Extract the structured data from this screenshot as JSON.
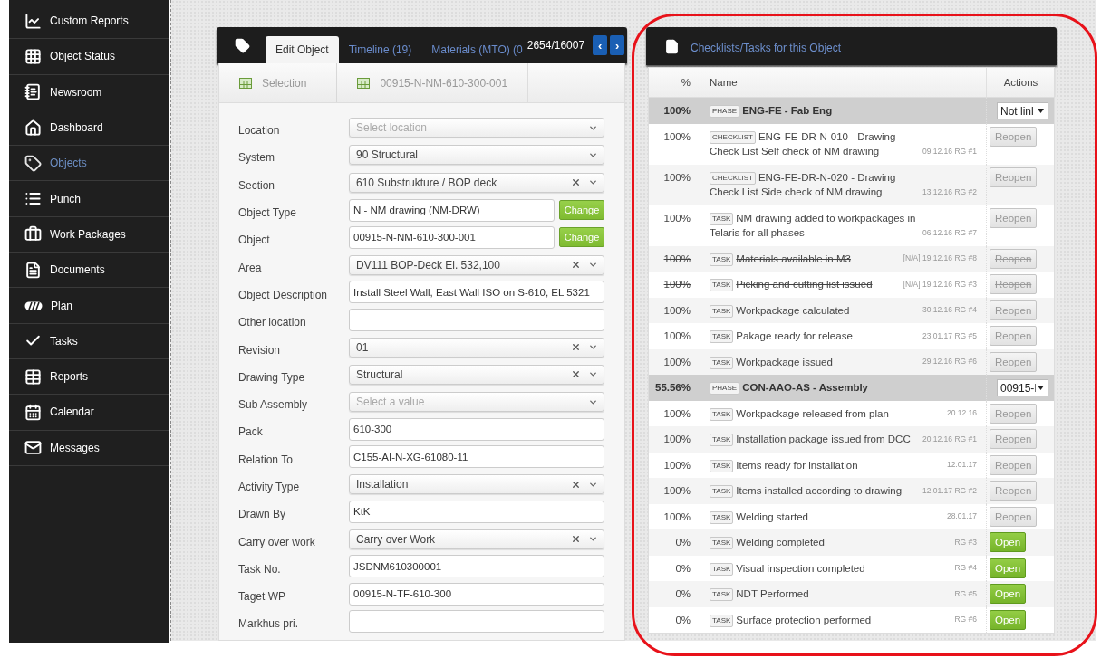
{
  "sidebar": {
    "items": [
      {
        "label": "Custom Reports",
        "selected": false
      },
      {
        "label": "Object Status",
        "selected": false
      },
      {
        "label": "Newsroom",
        "selected": false
      },
      {
        "label": "Dashboard",
        "selected": false
      },
      {
        "label": "Objects",
        "selected": true
      },
      {
        "label": "Punch",
        "selected": false
      },
      {
        "label": "Work Packages",
        "selected": false
      },
      {
        "label": "Documents",
        "selected": false
      },
      {
        "label": "Plan",
        "selected": false
      },
      {
        "label": "Tasks",
        "selected": false
      },
      {
        "label": "Reports",
        "selected": false
      },
      {
        "label": "Calendar",
        "selected": false
      },
      {
        "label": "Messages",
        "selected": false
      }
    ]
  },
  "edit_panel": {
    "tabs": [
      {
        "label": "Edit Object",
        "selected": true
      },
      {
        "label": "Timeline (19)",
        "selected": false
      },
      {
        "label": "Materials (MTO) (0",
        "selected": false
      }
    ],
    "counter": "2654/16007",
    "nav_buttons": [
      "‹",
      "›"
    ],
    "breadcrumb": [
      "Selection",
      "00915-N-NM-610-300-001"
    ],
    "fields": [
      {
        "label": "Location",
        "kind": "select",
        "placeholder": "Select location",
        "clearable": false
      },
      {
        "label": "System",
        "kind": "select",
        "value": "90 Structural",
        "clearable": false
      },
      {
        "label": "Section",
        "kind": "select",
        "value": "610 Substrukture / BOP deck",
        "clearable": true
      },
      {
        "label": "Object Type",
        "kind": "input",
        "value": "N - NM drawing (NM-DRW)",
        "button": "Change"
      },
      {
        "label": "Object",
        "kind": "input",
        "value": "00915-N-NM-610-300-001",
        "button": "Change"
      },
      {
        "label": "Area",
        "kind": "select",
        "value": "DV111 BOP-Deck El. 532,100",
        "clearable": true
      },
      {
        "label": "Object Description",
        "kind": "input",
        "value": "Install Steel Wall, East Wall ISO on S-610, EL 5321"
      },
      {
        "label": "Other location",
        "kind": "input"
      },
      {
        "label": "Revision",
        "kind": "select",
        "value": "01",
        "clearable": true
      },
      {
        "label": "Drawing Type",
        "kind": "select",
        "value": "Structural",
        "clearable": true
      },
      {
        "label": "Sub Assembly",
        "kind": "select",
        "placeholder": "Select a value",
        "clearable": false
      },
      {
        "label": "Pack",
        "kind": "input",
        "value": "610-300"
      },
      {
        "label": "Relation To",
        "kind": "input",
        "value": "C155-AI-N-XG-61080-11"
      },
      {
        "label": "Activity Type",
        "kind": "select",
        "value": "Installation",
        "clearable": true
      },
      {
        "label": "Drawn By",
        "kind": "input",
        "value": "KtK"
      },
      {
        "label": "Carry over work",
        "kind": "select",
        "value": "Carry over Work",
        "clearable": true
      },
      {
        "label": "Task No.",
        "kind": "input",
        "value": "JSDNM610300001"
      },
      {
        "label": "Taget WP",
        "kind": "input",
        "value": "00915-N-TF-610-300"
      },
      {
        "label": "Markhus pri.",
        "kind": "input"
      }
    ]
  },
  "tasks_panel": {
    "title": "Checklists/Tasks for this Object",
    "columns": [
      "%",
      "Name",
      "Actions"
    ],
    "rows": [
      {
        "kind": "phase",
        "percent": "100%",
        "tag": "PHASE",
        "name": "ENG-FE - Fab Eng",
        "action": {
          "kind": "select",
          "label": "Not linl"
        }
      },
      {
        "kind": "item",
        "percent": "100%",
        "tag": "CHECKLIST",
        "name": "ENG-FE-DR-N-010 - Drawing Check List Self check of NM drawing",
        "meta": "09.12.16 RG #1",
        "struck": false,
        "action": {
          "kind": "reopen",
          "label": "Reopen"
        }
      },
      {
        "kind": "item",
        "percent": "100%",
        "tag": "CHECKLIST",
        "name": "ENG-FE-DR-N-020 - Drawing Check List Side check of NM drawing",
        "meta": "13.12.16 RG #2",
        "struck": false,
        "action": {
          "kind": "reopen",
          "label": "Reopen"
        }
      },
      {
        "kind": "item",
        "percent": "100%",
        "tag": "TASK",
        "name": "NM drawing added to workpackages in Telaris for all phases",
        "meta": "06.12.16 RG #7",
        "struck": false,
        "action": {
          "kind": "reopen",
          "label": "Reopen"
        }
      },
      {
        "kind": "item",
        "percent": "100%",
        "tag": "TASK",
        "name": "Materials available in M3",
        "meta": "[N/A] 19.12.16 RG #8",
        "struck": true,
        "action": {
          "kind": "reopen",
          "label": "Reopen"
        }
      },
      {
        "kind": "item",
        "percent": "100%",
        "tag": "TASK",
        "name": "Picking and cutting list issued",
        "meta": "[N/A] 19.12.16 RG #3",
        "struck": true,
        "action": {
          "kind": "reopen",
          "label": "Reopen"
        }
      },
      {
        "kind": "item",
        "percent": "100%",
        "tag": "TASK",
        "name": "Workpackage calculated",
        "meta": "30.12.16 RG #4",
        "struck": false,
        "action": {
          "kind": "reopen",
          "label": "Reopen"
        }
      },
      {
        "kind": "item",
        "percent": "100%",
        "tag": "TASK",
        "name": "Pakage ready for release",
        "meta": "23.01.17 RG #5",
        "struck": false,
        "action": {
          "kind": "reopen",
          "label": "Reopen"
        }
      },
      {
        "kind": "item",
        "percent": "100%",
        "tag": "TASK",
        "name": "Workpackage issued",
        "meta": "29.12.16 RG #6",
        "struck": false,
        "action": {
          "kind": "reopen",
          "label": "Reopen"
        }
      },
      {
        "kind": "phase",
        "percent": "55.56%",
        "tag": "PHASE",
        "name": "CON-AAO-AS - Assembly",
        "action": {
          "kind": "select",
          "label": "00915-I"
        }
      },
      {
        "kind": "item",
        "percent": "100%",
        "tag": "TASK",
        "name": "Workpackage released from plan",
        "meta": "20.12.16",
        "struck": false,
        "action": {
          "kind": "reopen",
          "label": "Reopen"
        }
      },
      {
        "kind": "item",
        "percent": "100%",
        "tag": "TASK",
        "name": "Installation package issued from DCC",
        "meta": "20.12.16 RG #1",
        "struck": false,
        "action": {
          "kind": "reopen",
          "label": "Reopen"
        }
      },
      {
        "kind": "item",
        "percent": "100%",
        "tag": "TASK",
        "name": "Items ready for installation",
        "meta": "12.01.17",
        "struck": false,
        "action": {
          "kind": "reopen",
          "label": "Reopen"
        }
      },
      {
        "kind": "item",
        "percent": "100%",
        "tag": "TASK",
        "name": "Items installed according to drawing",
        "meta": "12.01.17 RG #2",
        "struck": false,
        "action": {
          "kind": "reopen",
          "label": "Reopen"
        }
      },
      {
        "kind": "item",
        "percent": "100%",
        "tag": "TASK",
        "name": "Welding started",
        "meta": "28.01.17",
        "struck": false,
        "action": {
          "kind": "reopen",
          "label": "Reopen"
        }
      },
      {
        "kind": "item",
        "percent": "0%",
        "tag": "TASK",
        "name": "Welding completed",
        "meta": "RG #3",
        "struck": false,
        "action": {
          "kind": "open",
          "label": "Open"
        }
      },
      {
        "kind": "item",
        "percent": "0%",
        "tag": "TASK",
        "name": "Visual inspection completed",
        "meta": "RG #4",
        "struck": false,
        "action": {
          "kind": "open",
          "label": "Open"
        }
      },
      {
        "kind": "item",
        "percent": "0%",
        "tag": "TASK",
        "name": "NDT Performed",
        "meta": "RG #5",
        "struck": false,
        "action": {
          "kind": "open",
          "label": "Open"
        }
      },
      {
        "kind": "item",
        "percent": "0%",
        "tag": "TASK",
        "name": "Surface protection performed",
        "meta": "RG #6",
        "struck": false,
        "action": {
          "kind": "open",
          "label": "Open"
        }
      }
    ]
  }
}
